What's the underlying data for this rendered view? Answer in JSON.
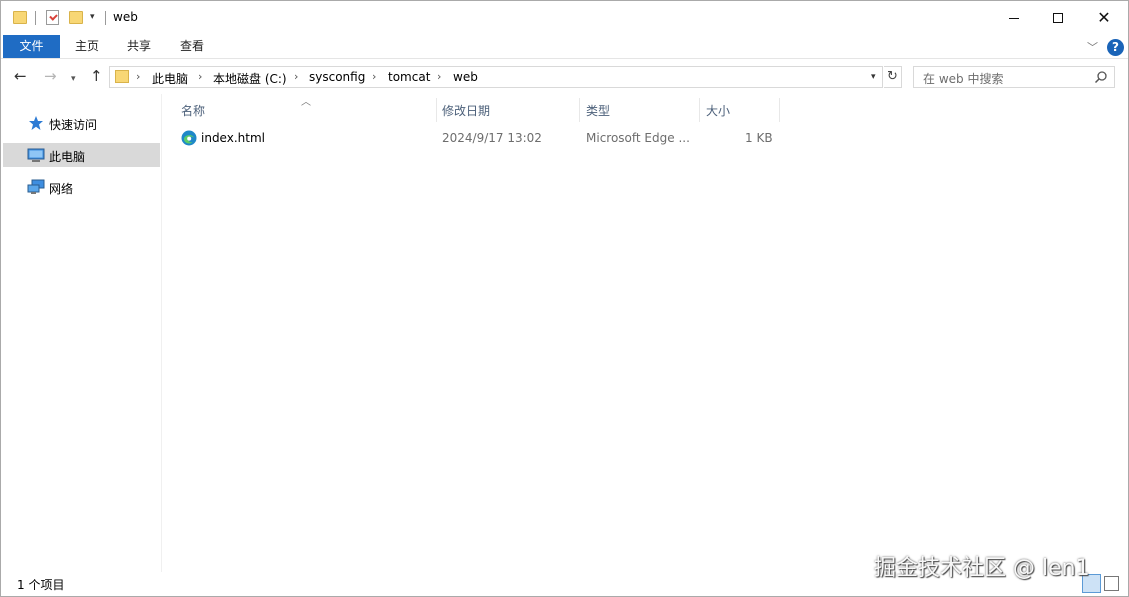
{
  "window": {
    "title": "web",
    "quick_access_dropdown": "▾"
  },
  "ribbon": {
    "tabs": [
      {
        "label": "文件"
      },
      {
        "label": "主页"
      },
      {
        "label": "共享"
      },
      {
        "label": "查看"
      }
    ],
    "help": "?"
  },
  "address": {
    "crumbs": [
      "此电脑",
      "本地磁盘 (C:)",
      "sysconfig",
      "tomcat",
      "web"
    ]
  },
  "search": {
    "placeholder": "在 web 中搜索"
  },
  "sidebar": {
    "items": [
      {
        "label": "快速访问",
        "icon": "star-icon"
      },
      {
        "label": "此电脑",
        "icon": "computer-icon",
        "selected": true
      },
      {
        "label": "网络",
        "icon": "network-icon"
      }
    ]
  },
  "columns": [
    {
      "label": "名称"
    },
    {
      "label": "修改日期"
    },
    {
      "label": "类型"
    },
    {
      "label": "大小"
    }
  ],
  "files": [
    {
      "name": "index.html",
      "modified": "2024/9/17 13:02",
      "type": "Microsoft Edge ...",
      "size": "1 KB",
      "icon": "edge-icon"
    }
  ],
  "status": {
    "item_count": "1 个项目"
  },
  "watermark": "掘金技术社区 @ len1",
  "colors": {
    "accent": "#1f6cc4",
    "selected_bg": "#d9d9d9",
    "header_text": "#4c607a",
    "folder": "#f8d775"
  }
}
